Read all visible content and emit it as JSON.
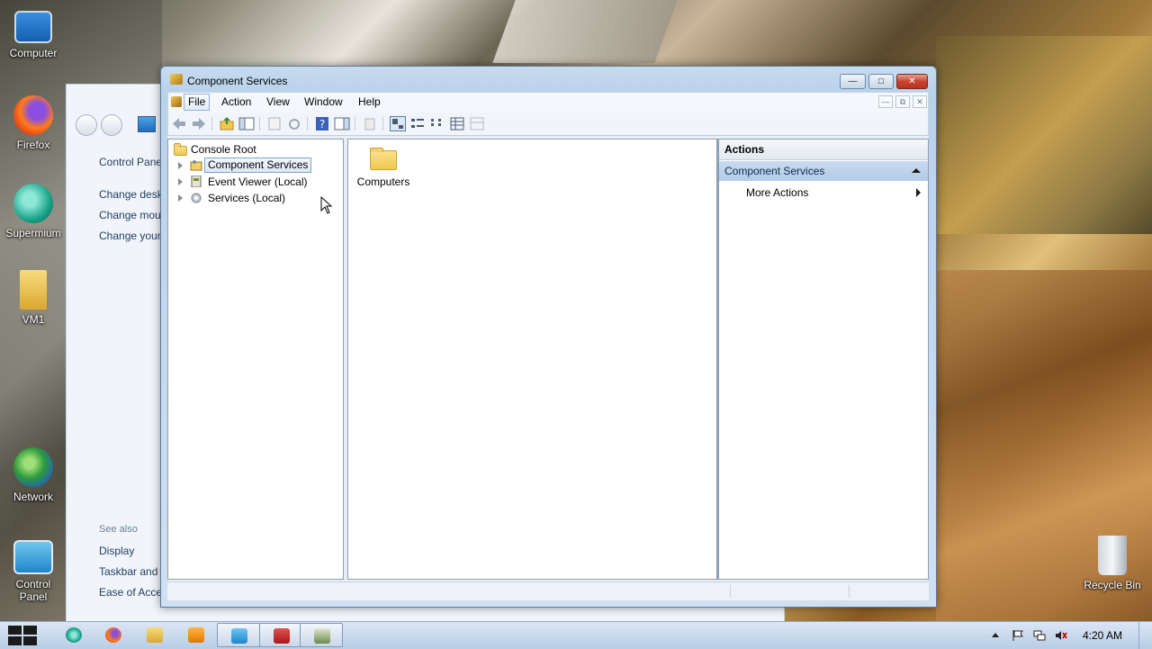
{
  "desktop": {
    "icons": [
      {
        "label": "Computer"
      },
      {
        "label": "Firefox"
      },
      {
        "label": "Supermium"
      },
      {
        "label": "VM1"
      },
      {
        "label": "Network"
      },
      {
        "label": "Control Panel"
      },
      {
        "label": "Recycle Bin"
      }
    ]
  },
  "control_panel_bg": {
    "links": [
      "Control Pane",
      "Change desk",
      "Change mou",
      "Change your"
    ],
    "see_also_heading": "See also",
    "see_also": [
      "Display",
      "Taskbar and",
      "Ease of Acce"
    ]
  },
  "window": {
    "title": "Component Services",
    "menu": [
      "File",
      "Action",
      "View",
      "Window",
      "Help"
    ],
    "active_menu": "File"
  },
  "tree": {
    "root": "Console Root",
    "items": [
      {
        "label": "Component Services",
        "selected": true
      },
      {
        "label": "Event Viewer (Local)",
        "selected": false
      },
      {
        "label": "Services (Local)",
        "selected": false
      }
    ]
  },
  "listview": {
    "items": [
      {
        "label": "Computers",
        "icon": "folder-icon"
      }
    ]
  },
  "actions": {
    "header": "Actions",
    "section": "Component Services",
    "items": [
      {
        "label": "More Actions"
      }
    ]
  },
  "taskbar": {
    "clock": "4:20 AM"
  },
  "colors": {
    "accent": "#b9d1ea",
    "selection": "#dbe8f6",
    "close": "#c7452f"
  }
}
